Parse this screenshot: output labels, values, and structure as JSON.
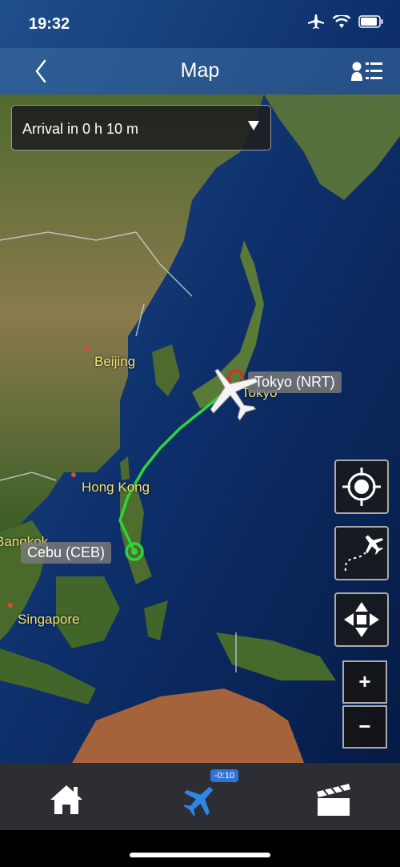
{
  "status_bar": {
    "time": "19:32"
  },
  "nav": {
    "title": "Map"
  },
  "arrival_dropdown": {
    "value": "Arrival in 0 h 10 m"
  },
  "cities": [
    {
      "name": "Beijing"
    },
    {
      "name": "Hong Kong"
    },
    {
      "name": "Bangkok"
    },
    {
      "name": "Singapore"
    },
    {
      "name": "Tokyo"
    }
  ],
  "flight": {
    "origin_label": "Cebu (CEB)",
    "destination_label": "Tokyo (NRT)"
  },
  "map_controls": {
    "zoom_in": "+",
    "zoom_out": "−"
  },
  "tab_bar": {
    "flight_badge": "-0:10"
  },
  "colors": {
    "route": "#2fd43a",
    "nav_bar": "#3c6ea0",
    "tab_active": "#2f86e6",
    "tab_bar": "#2d2e33"
  },
  "icons": [
    "back-icon",
    "user-list-icon",
    "airplane-mode-icon",
    "wifi-icon",
    "battery-icon",
    "caret-down-icon",
    "locate-icon",
    "flight-path-icon",
    "pan-icon",
    "home-icon",
    "airplane-icon",
    "clapperboard-icon"
  ]
}
